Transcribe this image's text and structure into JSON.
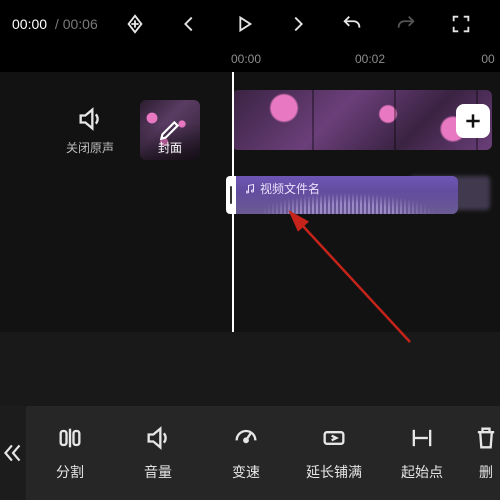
{
  "top": {
    "time_current": "00:00",
    "time_total": "00:06",
    "icons": {
      "keyframe": "keyframe-icon",
      "prev": "prev-icon",
      "play": "play-icon",
      "next": "next-icon",
      "undo": "undo-icon",
      "redo": "redo-icon",
      "fullscreen": "fullscreen-icon"
    }
  },
  "ruler": {
    "ticks": [
      "00:00",
      "00:02",
      "00"
    ]
  },
  "side": {
    "mute_label": "关闭原声",
    "cover_label": "封面"
  },
  "audio": {
    "filename": "视频文件名"
  },
  "toolbar": {
    "collapse": "«",
    "tools": [
      {
        "id": "split",
        "label": "分割"
      },
      {
        "id": "volume",
        "label": "音量"
      },
      {
        "id": "speed",
        "label": "变速"
      },
      {
        "id": "extend",
        "label": "延长铺满"
      },
      {
        "id": "start",
        "label": "起始点"
      },
      {
        "id": "delete",
        "label": "删"
      }
    ]
  },
  "colors": {
    "audio_track": "#5e4a97",
    "accent_arrow": "#c6231a"
  }
}
